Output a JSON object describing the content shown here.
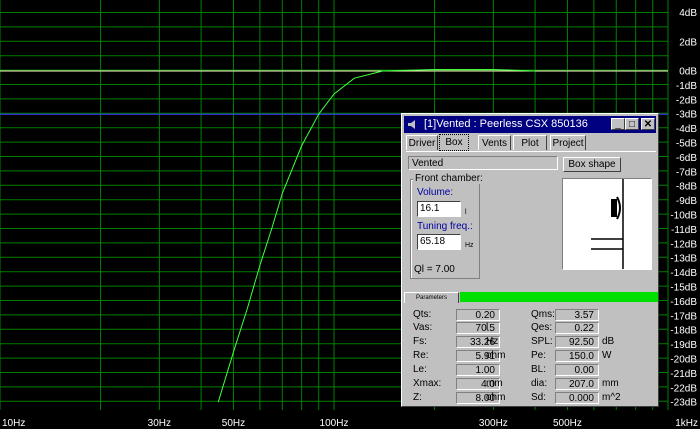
{
  "chart_data": {
    "type": "line",
    "x_axis": {
      "scale": "log",
      "ticks": [
        "10Hz",
        "30Hz",
        "50Hz",
        "100Hz",
        "300Hz",
        "500Hz",
        "1kHz"
      ]
    },
    "y_axis": {
      "unit": "dB",
      "ticks": [
        "4dB",
        "2dB",
        "0dB",
        "-1dB",
        "-2dB",
        "-3dB",
        "-4dB",
        "-5dB",
        "-6dB",
        "-7dB",
        "-8dB",
        "-9dB",
        "-10dB",
        "-11dB",
        "-12dB",
        "-13dB",
        "-14dB",
        "-15dB",
        "-16dB",
        "-17dB",
        "-18dB",
        "-19dB",
        "-20dB",
        "-21dB",
        "-22dB",
        "-23dB"
      ]
    },
    "reference_lines": {
      "zero_db": "0dB",
      "minus3_db": "-3dB"
    },
    "series": [
      {
        "points": [
          [
            45,
            -23
          ],
          [
            50,
            -19.5
          ],
          [
            55,
            -16.5
          ],
          [
            60,
            -13.5
          ],
          [
            65,
            -11
          ],
          [
            70,
            -8.5
          ],
          [
            80,
            -5.2
          ],
          [
            90,
            -3
          ],
          [
            100,
            -1.6
          ],
          [
            115,
            -0.5
          ],
          [
            140,
            0
          ],
          [
            200,
            0.1
          ],
          [
            300,
            0.1
          ],
          [
            400,
            0
          ]
        ]
      }
    ],
    "colors": {
      "grid": "#008000",
      "curve": "#40ff40",
      "zero_line": "#ffffc0",
      "minus3_line": "#4040ff",
      "labels": "#ffffff"
    }
  },
  "window": {
    "title": "[1]Vented : Peerless CSX 850136",
    "tabs": [
      "Driver",
      "Box",
      "Vents",
      "Plot",
      "Project"
    ],
    "active_tab": "Box",
    "box_type": "Vented",
    "box_shape_button": "Box shape",
    "front_chamber_label": "Front chamber:",
    "volume_label": "Volume:",
    "volume_value": "16.1",
    "volume_unit": "l",
    "tuning_label": "Tuning freq.:",
    "tuning_value": "65.18",
    "tuning_unit": "Hz",
    "ql": "Ql = 7.00",
    "parameters_tab": "Parameters",
    "params_left": [
      {
        "label": "Qts:",
        "value": "0.20",
        "unit": ""
      },
      {
        "label": "Vas:",
        "value": "70.5",
        "unit": "l"
      },
      {
        "label": "Fs:",
        "value": "33.26",
        "unit": "Hz"
      },
      {
        "label": "Re:",
        "value": "5.91",
        "unit": "ohm"
      },
      {
        "label": "Le:",
        "value": "1.00",
        "unit": ""
      },
      {
        "label": "Xmax:",
        "value": "4.0",
        "unit": "mm"
      },
      {
        "label": "Z:",
        "value": "8.00",
        "unit": "ohm"
      }
    ],
    "params_right": [
      {
        "label": "Qms:",
        "value": "3.57",
        "unit": ""
      },
      {
        "label": "Qes:",
        "value": "0.22",
        "unit": ""
      },
      {
        "label": "SPL:",
        "value": "92.50",
        "unit": "dB"
      },
      {
        "label": "Pe:",
        "value": "150.0",
        "unit": "W"
      },
      {
        "label": "BL:",
        "value": "0.00",
        "unit": ""
      },
      {
        "label": "dia:",
        "value": "207.0",
        "unit": "mm"
      },
      {
        "label": "Sd:",
        "value": "0.000",
        "unit": "m^2"
      }
    ],
    "icons": [
      "speaker-icon",
      "minimize-icon",
      "maximize-icon",
      "close-icon"
    ]
  }
}
